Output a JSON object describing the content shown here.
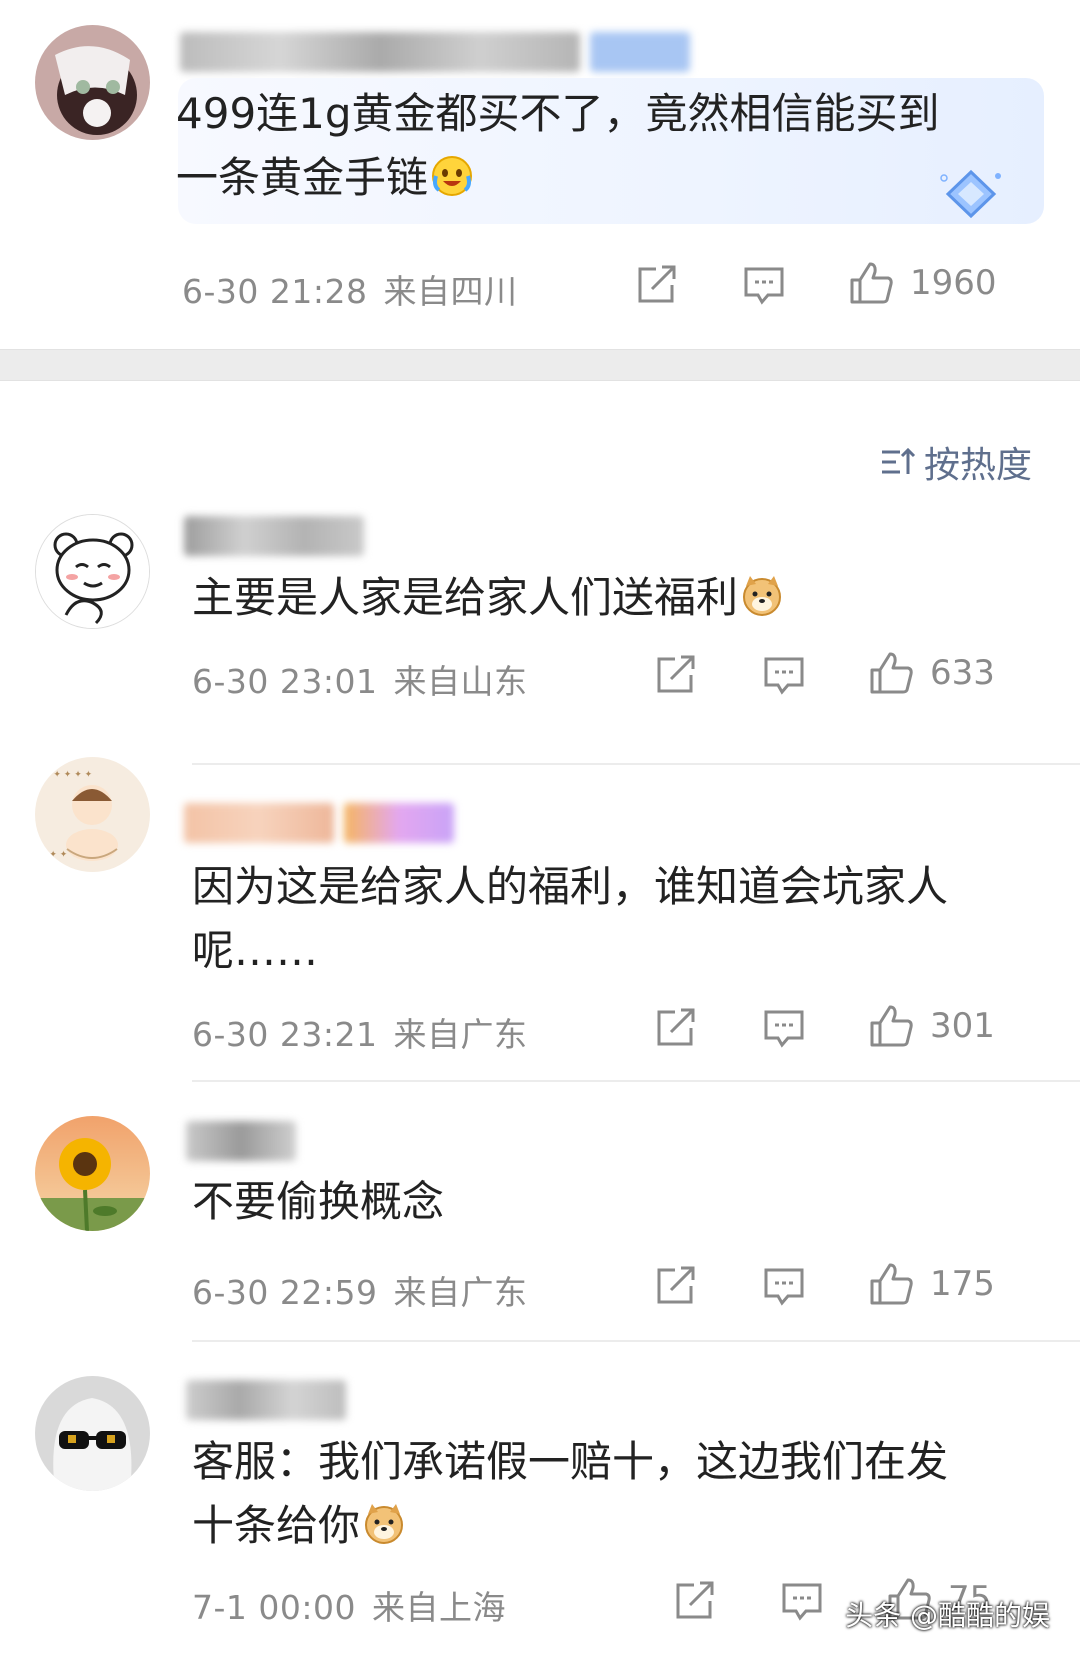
{
  "sort_label": "按热度",
  "watermark": "头条 @酷酷的娱",
  "comments": [
    {
      "text_line1": "499连1g黄金都买不了，竟然相信能买到",
      "text_line2": "一条黄金手链",
      "time": "6-30 21:28",
      "location": "来自四川",
      "likes": "1960",
      "emoji": "crying-laughing-emoji"
    },
    {
      "text_line1": "主要是人家是给家人们送福利",
      "time": "6-30 23:01",
      "location": "来自山东",
      "likes": "633",
      "emoji": "doge-emoji"
    },
    {
      "text_line1": "因为这是给家人的福利，谁知道会坑家人",
      "text_line2": "呢……",
      "time": "6-30 23:21",
      "location": "来自广东",
      "likes": "301"
    },
    {
      "text_line1": "不要偷换概念",
      "time": "6-30 22:59",
      "location": "来自广东",
      "likes": "175"
    },
    {
      "text_line1": "客服：我们承诺假一赔十，这边我们在发",
      "text_line2": "十条给你",
      "time": "7-1 00:00",
      "location": "来自上海",
      "likes": "75",
      "emoji": "doge-emoji"
    }
  ],
  "colors": {
    "meta_gray": "#8a8a8a",
    "sort_blue": "#5f6f8d",
    "divider": "#ececec"
  }
}
